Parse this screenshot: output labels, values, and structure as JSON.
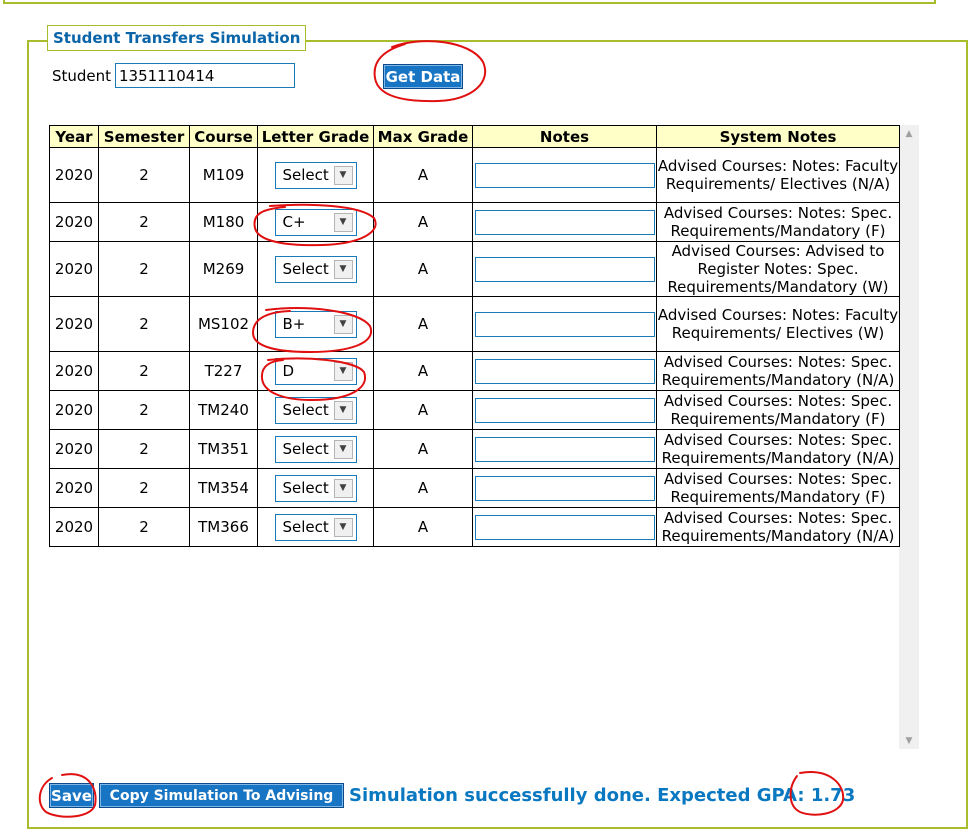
{
  "form": {
    "legend": "Student Transfers Simulation",
    "student_label": "Student",
    "student_value": "1351110414",
    "get_data_label": "Get Data"
  },
  "table": {
    "headers": {
      "year": "Year",
      "semester": "Semester",
      "course": "Course",
      "letter_grade": "Letter Grade",
      "max_grade": "Max Grade",
      "notes": "Notes",
      "system_notes": "System Notes"
    },
    "rows": [
      {
        "year": "2020",
        "semester": "2",
        "course": "M109",
        "grade": "Select",
        "max_grade": "A",
        "system_notes": "Advised Courses: Notes: Faculty Requirements/ Electives (N/A)"
      },
      {
        "year": "2020",
        "semester": "2",
        "course": "M180",
        "grade": "C+",
        "max_grade": "A",
        "system_notes": "Advised Courses: Notes: Spec. Requirements/Mandatory (F)"
      },
      {
        "year": "2020",
        "semester": "2",
        "course": "M269",
        "grade": "Select",
        "max_grade": "A",
        "system_notes": "Advised Courses: Advised to Register Notes: Spec. Requirements/Mandatory (W)"
      },
      {
        "year": "2020",
        "semester": "2",
        "course": "MS102",
        "grade": "B+",
        "max_grade": "A",
        "system_notes": "Advised Courses: Notes: Faculty Requirements/ Electives (W)"
      },
      {
        "year": "2020",
        "semester": "2",
        "course": "T227",
        "grade": "D",
        "max_grade": "A",
        "system_notes": "Advised Courses: Notes: Spec. Requirements/Mandatory (N/A)"
      },
      {
        "year": "2020",
        "semester": "2",
        "course": "TM240",
        "grade": "Select",
        "max_grade": "A",
        "system_notes": "Advised Courses: Notes: Spec. Requirements/Mandatory (F)"
      },
      {
        "year": "2020",
        "semester": "2",
        "course": "TM351",
        "grade": "Select",
        "max_grade": "A",
        "system_notes": "Advised Courses: Notes: Spec. Requirements/Mandatory (N/A)"
      },
      {
        "year": "2020",
        "semester": "2",
        "course": "TM354",
        "grade": "Select",
        "max_grade": "A",
        "system_notes": "Advised Courses: Notes: Spec. Requirements/Mandatory (F)"
      },
      {
        "year": "2020",
        "semester": "2",
        "course": "TM366",
        "grade": "Select",
        "max_grade": "A",
        "system_notes": "Advised Courses: Notes: Spec. Requirements/Mandatory (N/A)"
      }
    ]
  },
  "footer": {
    "save_label": "Save",
    "copy_label": "Copy Simulation To Advising",
    "status_text": "Simulation successfully done. Expected GPA:",
    "gpa_value": "1.73"
  },
  "icons": {
    "dropdown_arrow": "chevron-down-icon",
    "scroll_up": "scroll-up-arrow-icon",
    "scroll_down": "scroll-down-arrow-icon"
  },
  "colors": {
    "border_green": "#a8bc2c",
    "accent_blue": "#0a78c0",
    "button_blue": "#1875c4",
    "header_yellow": "#ffffc8",
    "annotation_red": "#e01010"
  }
}
